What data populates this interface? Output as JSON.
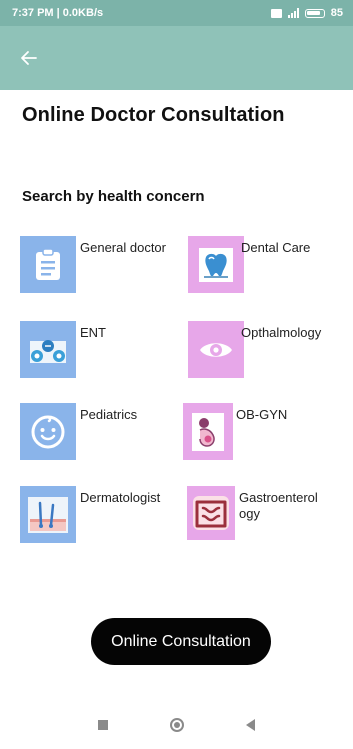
{
  "status_bar": {
    "time_speed": "7:37 PM | 0.0KB/s",
    "battery": "85"
  },
  "header": {
    "title": "Online Doctor Consultation"
  },
  "section": {
    "title": "Search by health concern"
  },
  "categories": [
    {
      "label": "General doctor",
      "icon": "clipboard-icon",
      "bg": "#8ab4ea"
    },
    {
      "label": "Dental Care",
      "icon": "tooth-icon",
      "bg": "#e7a7e9"
    },
    {
      "label": "ENT",
      "icon": "ent-icon",
      "bg": "#8ab4ea"
    },
    {
      "label": "Opthalmology",
      "icon": "eye-icon",
      "bg": "#e7a7e9"
    },
    {
      "label": "Pediatrics",
      "icon": "baby-face-icon",
      "bg": "#8ab4ea"
    },
    {
      "label": "OB-GYN",
      "icon": "pregnancy-icon",
      "bg": "#e7a7e9"
    },
    {
      "label": "Dermatologist",
      "icon": "skin-hair-icon",
      "bg": "#8ab4ea"
    },
    {
      "label": "Gastroenterol\nogy",
      "icon": "intestine-icon",
      "bg": "#e7a7e9"
    }
  ],
  "cta": {
    "label": "Online Consultation"
  },
  "colors": {
    "appbar": "#8fc2b8",
    "statusbar": "#7cb3a9",
    "button": "#050505"
  }
}
